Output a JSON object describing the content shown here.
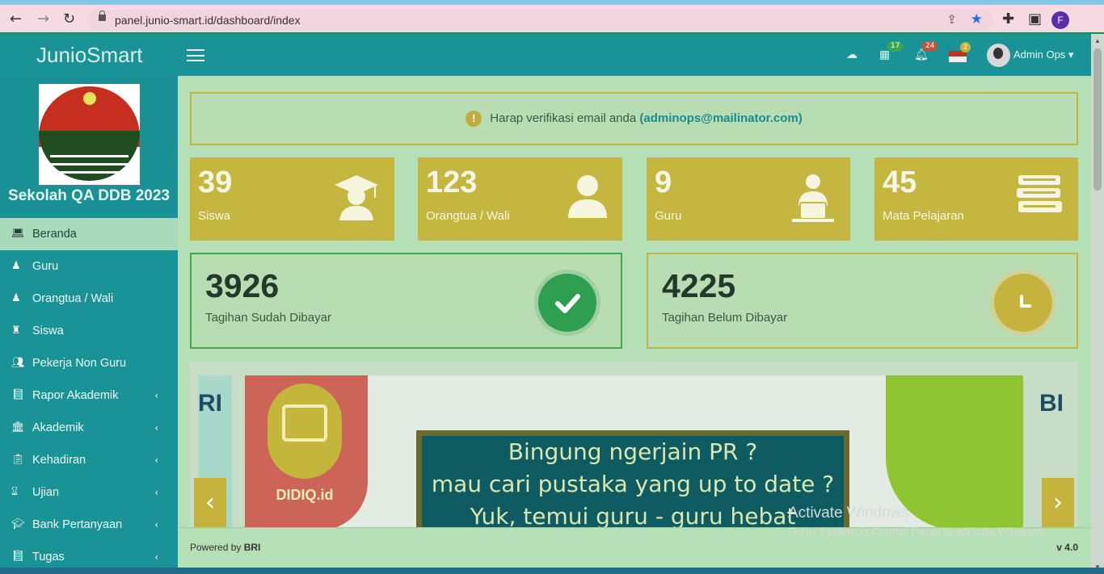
{
  "browser": {
    "url": "panel.junio-smart.id/dashboard/index",
    "profile_initial": "F"
  },
  "topbar": {
    "brand": "JunioSmart",
    "badges": {
      "calendar": "17",
      "bell": "24",
      "flag": "2"
    },
    "user_name": "Admin Ops"
  },
  "sidebar": {
    "school_name": "Sekolah QA DDB 2023",
    "items": [
      {
        "label": "Beranda",
        "icon": "laptop-icon"
      },
      {
        "label": "Guru",
        "icon": "user-icon"
      },
      {
        "label": "Orangtua / Wali",
        "icon": "user-icon"
      },
      {
        "label": "Siswa",
        "icon": "student-icon"
      },
      {
        "label": "Pekerja Non Guru",
        "icon": "users-icon"
      },
      {
        "label": "Rapor Akademik",
        "icon": "book-icon"
      },
      {
        "label": "Akademik",
        "icon": "building-icon"
      },
      {
        "label": "Kehadiran",
        "icon": "clipboard-icon"
      },
      {
        "label": "Ujian",
        "icon": "hourglass-icon"
      },
      {
        "label": "Bank Pertanyaan",
        "icon": "graduation-cap-icon"
      },
      {
        "label": "Tugas",
        "icon": "book-icon"
      }
    ]
  },
  "alert": {
    "text": "Harap verifikasi email anda",
    "email": "(adminops@mailinator.com)"
  },
  "stats": [
    {
      "value": "39",
      "label": "Siswa",
      "icon": "graduate-icon"
    },
    {
      "value": "123",
      "label": "Orangtua / Wali",
      "icon": "user-icon"
    },
    {
      "value": "9",
      "label": "Guru",
      "icon": "teacher-icon"
    },
    {
      "value": "45",
      "label": "Mata Pelajaran",
      "icon": "books-icon"
    }
  ],
  "bills": [
    {
      "value": "3926",
      "label": "Tagihan Sudah Dibayar",
      "icon": "check-icon",
      "color": "#2e9e4f"
    },
    {
      "value": "4225",
      "label": "Tagihan Belum Dibayar",
      "icon": "clock-icon",
      "color": "#c6b33e"
    }
  ],
  "banner": {
    "brand": "DIDIQ.id",
    "lines": [
      "Bingung ngerjain PR ?",
      "mau cari pustaka yang up to date ?",
      "Yuk, temui guru - guru hebat"
    ],
    "partial_left": "RI",
    "partial_right": "BI"
  },
  "footer": {
    "powered_prefix": "Powered by",
    "powered_brand": "BRI",
    "version": "v 4.0"
  },
  "watermark": {
    "title": "Activate Windows",
    "subtitle": "Go to System in Control Panel to activate Windows."
  }
}
